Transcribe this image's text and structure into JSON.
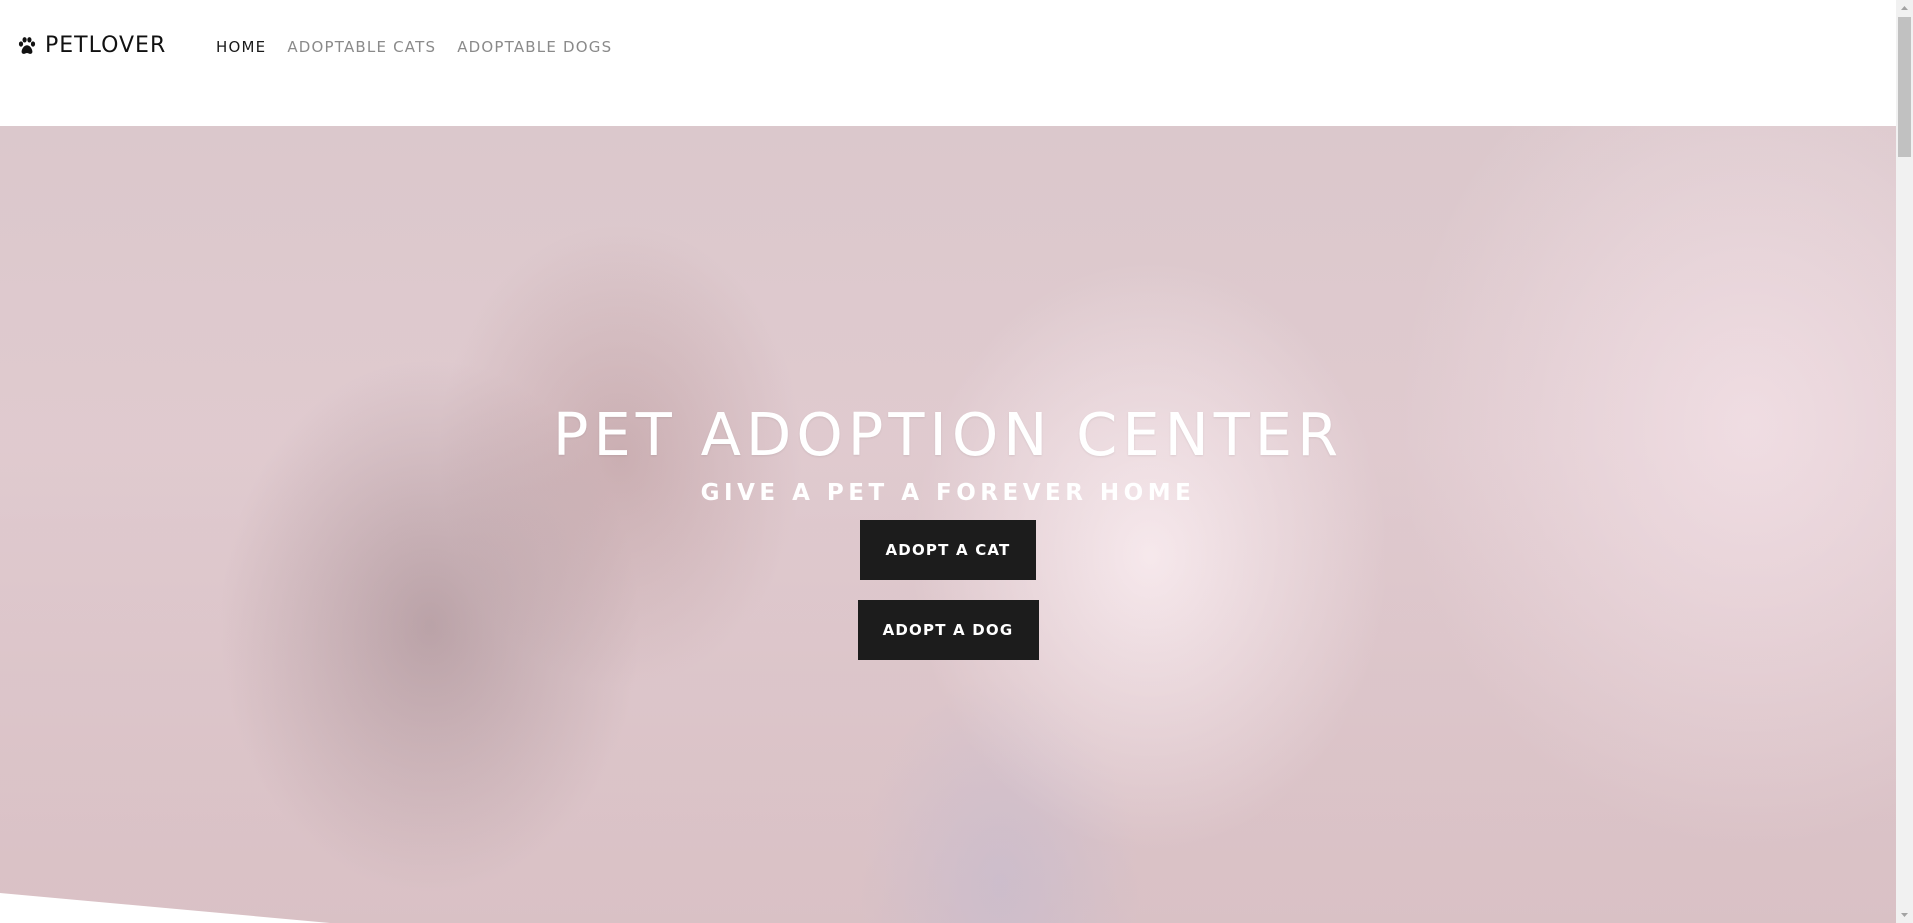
{
  "nav": {
    "brand": "PETLOVER",
    "links": [
      {
        "label": "HOME",
        "active": true
      },
      {
        "label": "ADOPTABLE CATS",
        "active": false
      },
      {
        "label": "ADOPTABLE DOGS",
        "active": false
      }
    ]
  },
  "hero": {
    "title": "PET ADOPTION CENTER",
    "subtitle": "GIVE A PET A FOREVER HOME",
    "cta_cat": "ADOPT A CAT",
    "cta_dog": "ADOPT A DOG"
  },
  "icons": {
    "brand_icon": "paw-icon"
  },
  "colors": {
    "button_bg": "#1c1c1c",
    "nav_active": "#1a1a1a",
    "nav_inactive": "#8a8a8a"
  }
}
